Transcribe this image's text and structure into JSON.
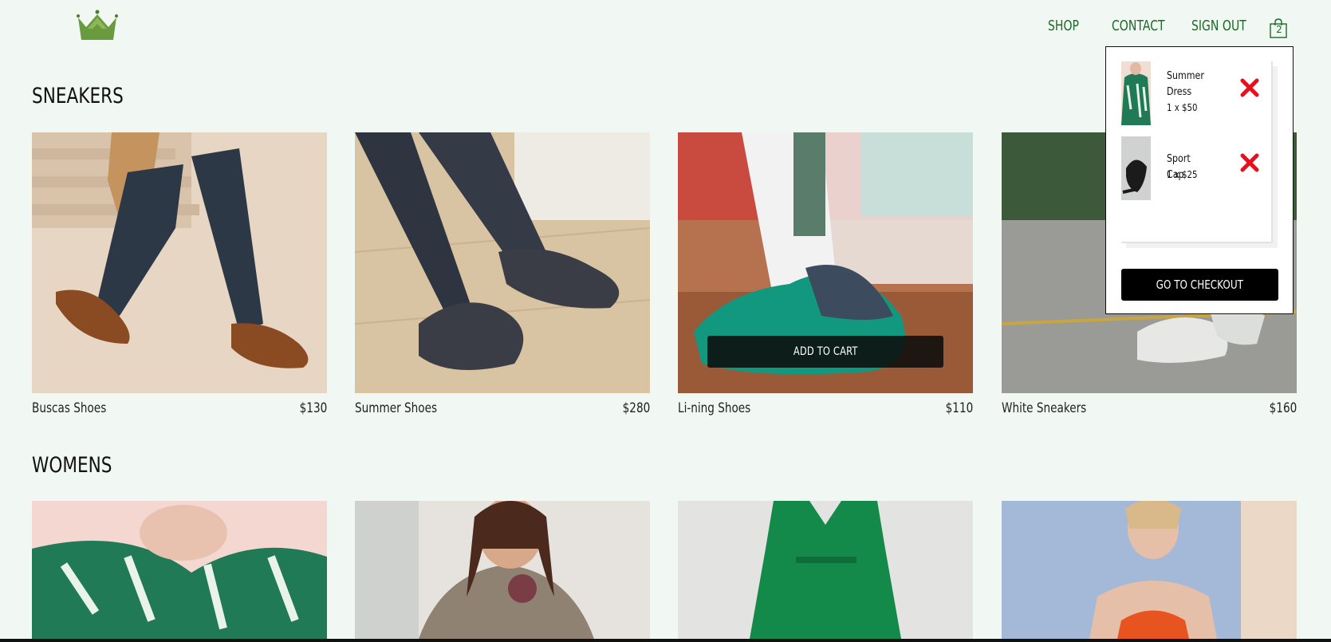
{
  "header": {
    "nav": {
      "shop": "SHOP",
      "contact": "CONTACT",
      "sign_out": "SIGN OUT"
    },
    "cart_count": "2"
  },
  "sections": [
    {
      "title": "SNEAKERS",
      "products": [
        {
          "name": "Buscas Shoes",
          "price": "$130"
        },
        {
          "name": "Summer Shoes",
          "price": "$280"
        },
        {
          "name": "Li-ning Shoes",
          "price": "$110",
          "hover_button": "ADD TO CART"
        },
        {
          "name": "White Sneakers",
          "price": "$160"
        }
      ]
    },
    {
      "title": "WOMENS",
      "products": [
        {
          "name": ""
        },
        {
          "name": ""
        },
        {
          "name": ""
        },
        {
          "name": ""
        }
      ]
    }
  ],
  "cart_dropdown": {
    "items": [
      {
        "name": "Summer Dress",
        "quantity_price": "1 x $50"
      },
      {
        "name": "Sport Cap",
        "quantity_price": "1 x $25"
      }
    ],
    "checkout_label": "GO TO CHECKOUT"
  },
  "colors": {
    "background": "#f1f7f2",
    "nav_text": "#1a6b25",
    "logo": "#6a9a3e",
    "remove": "#e8101c"
  },
  "icons": {
    "logo": "crown-icon",
    "cart": "shopping-bag-icon",
    "remove": "close-icon"
  }
}
